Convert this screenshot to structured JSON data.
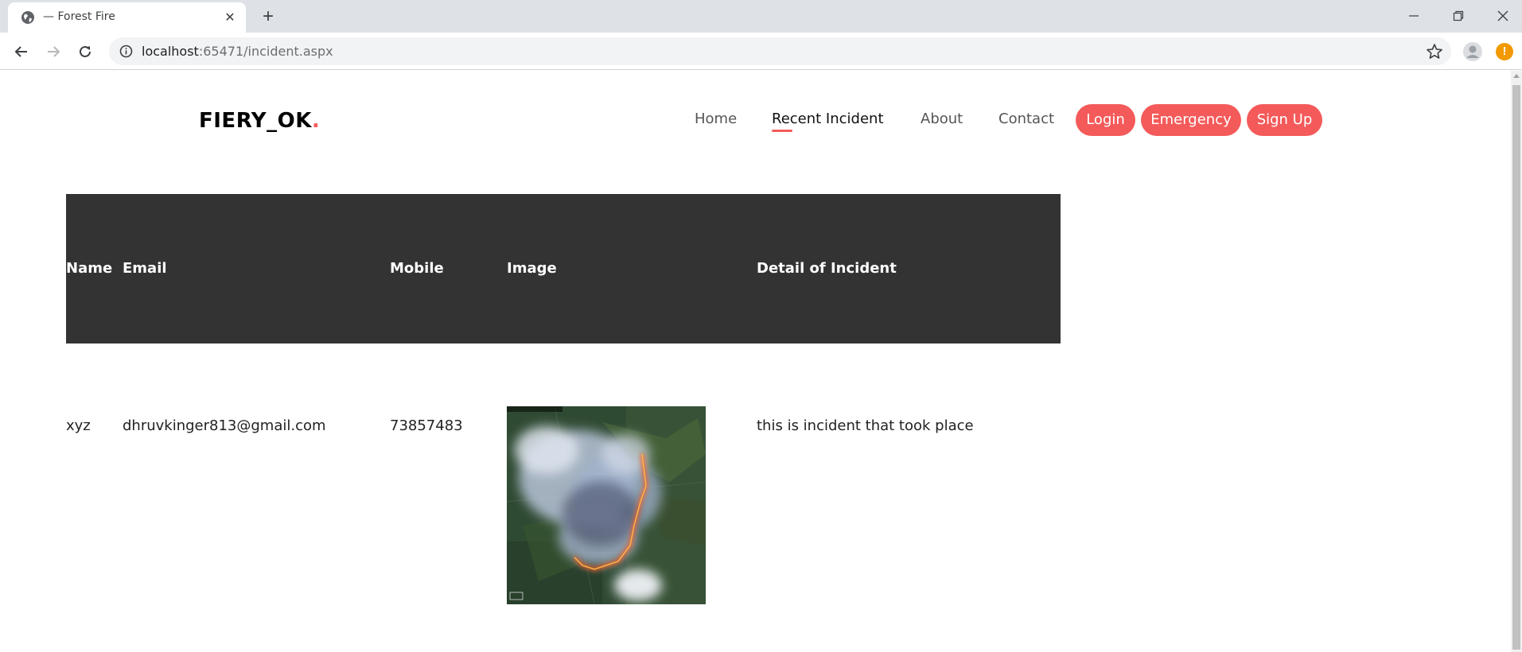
{
  "browser": {
    "tab_title": "— Forest Fire",
    "url_host": "localhost",
    "url_rest": ":65471/incident.aspx"
  },
  "site": {
    "logo_text": "FIERY_OK",
    "logo_dot": ".",
    "nav": {
      "home": "Home",
      "recent_incident": "Recent Incident",
      "about": "About",
      "contact": "Contact"
    },
    "buttons": {
      "login": "Login",
      "emergency": "Emergency",
      "signup": "Sign Up"
    },
    "accent_color": "#f45a5a"
  },
  "table": {
    "headers": [
      "Name",
      "Email",
      "Mobile",
      "Image",
      "Detail of Incident"
    ],
    "rows": [
      {
        "name": "xyz",
        "email": "dhruvkinger813@gmail.com",
        "mobile": "73857483",
        "image": "satellite-wildfire-image",
        "detail": "this is incident that took place"
      }
    ]
  }
}
